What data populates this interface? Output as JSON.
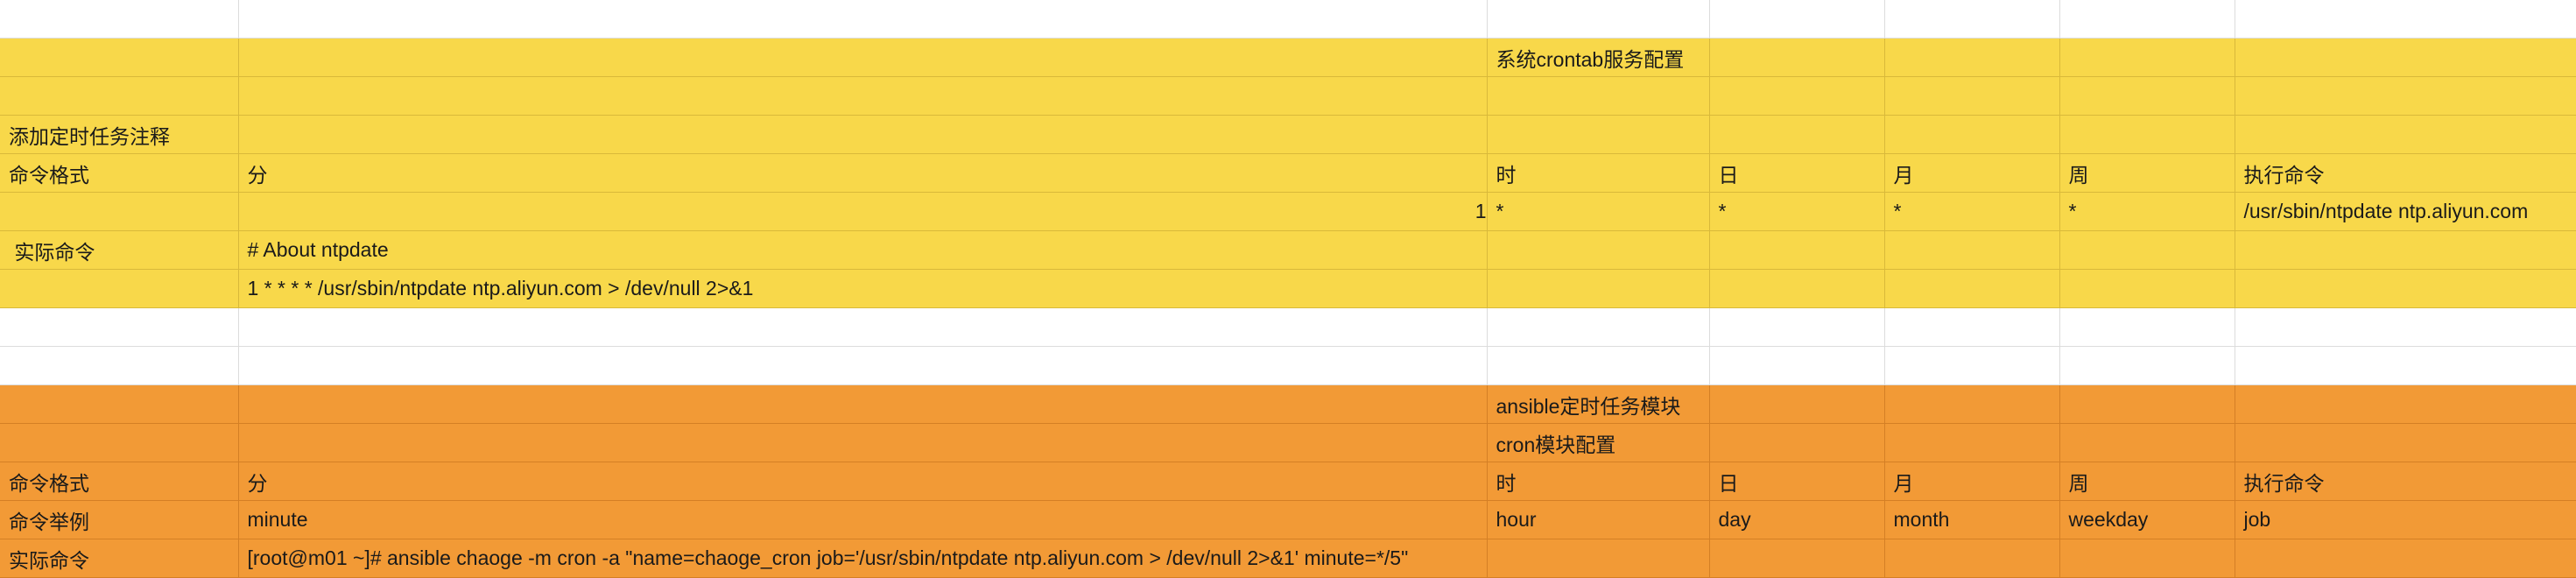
{
  "sections": {
    "crontab": {
      "title": "系统crontab服务配置",
      "comment_label": "添加定时任务注释",
      "format_row": {
        "label": "命令格式",
        "minute": "分",
        "hour": "时",
        "day": "日",
        "month": "月",
        "weekday": "周",
        "command": "执行命令"
      },
      "value_row": {
        "minute": "1",
        "hour": "*",
        "day": "*",
        "month": "*",
        "weekday": "*",
        "command": "/usr/sbin/ntpdate ntp.aliyun.com"
      },
      "actual_label": " 实际命令",
      "comment_line": "# About ntpdate",
      "cron_line": "1 * * * * /usr/sbin/ntpdate ntp.aliyun.com > /dev/null 2>&1"
    },
    "ansible": {
      "title": "ansible定时任务模块",
      "subtitle": "cron模块配置",
      "format_row": {
        "label": "命令格式",
        "minute": "分",
        "hour": "时",
        "day": "日",
        "month": "月",
        "weekday": "周",
        "command": "执行命令"
      },
      "example_row": {
        "label": "命令举例",
        "minute": "minute",
        "hour": "hour",
        "day": "day",
        "month": "month",
        "weekday": "weekday",
        "command": "job"
      },
      "actual_label": "实际命令",
      "actual_command": "[root@m01 ~]# ansible chaoge -m cron -a \"name=chaoge_cron job='/usr/sbin/ntpdate ntp.aliyun.com > /dev/null 2>&1' minute=*/5\""
    }
  },
  "colors": {
    "yellow": "#f8d84a",
    "orange": "#f29a36",
    "white": "#ffffff"
  }
}
